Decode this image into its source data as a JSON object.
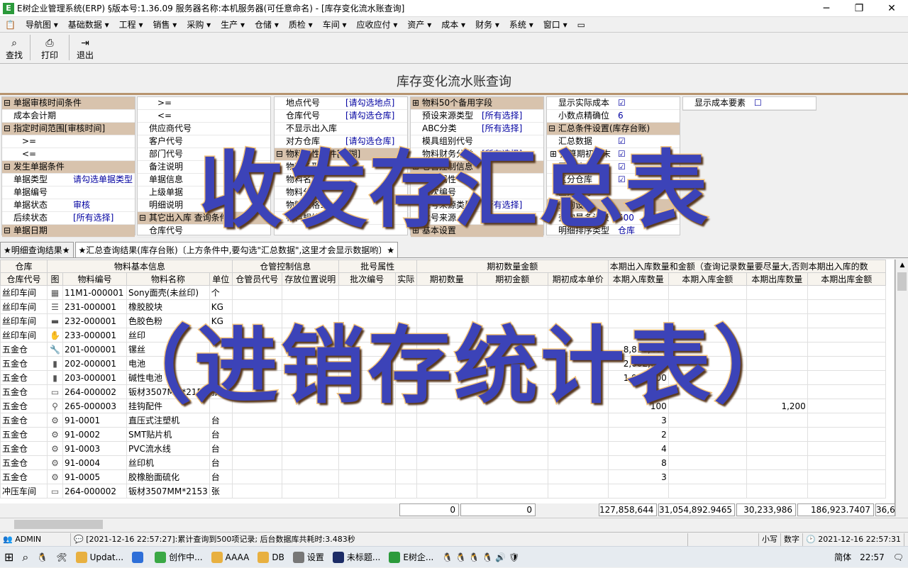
{
  "window": {
    "title": "E树企业管理系统(ERP) §版本号:1.36.09  服务器名称:本机服务器(可任意命名) - [库存变化流水账查询]",
    "minimize": "─",
    "maximize": "❐",
    "close": "✕"
  },
  "menu": [
    "导航图 ▾",
    "基础数据 ▾",
    "工程 ▾",
    "销售 ▾",
    "采购 ▾",
    "生产 ▾",
    "仓储 ▾",
    "质检 ▾",
    "车间 ▾",
    "应收应付 ▾",
    "资产 ▾",
    "成本 ▾",
    "财务 ▾",
    "系统 ▾",
    "窗口 ▾"
  ],
  "toolbar": {
    "find_label": "查找",
    "find_icon": "binoculars-icon",
    "print_label": "打印",
    "print_icon": "printer-icon",
    "exit_label": "退出",
    "exit_icon": "exit-door-icon"
  },
  "page_title": "库存变化流水账查询",
  "criteria": {
    "col1": [
      {
        "k": "⊟ 单据审核时间条件",
        "v": "",
        "group": true
      },
      {
        "k": "　成本会计期",
        "v": ""
      },
      {
        "k": "⊟ 指定时间范围[审核时间]",
        "v": "",
        "group": true
      },
      {
        "k": "　　>=",
        "v": ""
      },
      {
        "k": "　　<=",
        "v": ""
      },
      {
        "k": "⊟ 发生单据条件",
        "v": "",
        "group": true
      },
      {
        "k": "　单据类型",
        "v": "请勾选单据类型"
      },
      {
        "k": "　单据编号",
        "v": ""
      },
      {
        "k": "　单据状态",
        "v": "审核"
      },
      {
        "k": "　后续状态",
        "v": "[所有选择]"
      },
      {
        "k": "⊟ 单据日期",
        "v": "",
        "group": true
      }
    ],
    "col2": [
      {
        "k": "　　>=",
        "v": ""
      },
      {
        "k": "　　<=",
        "v": ""
      },
      {
        "k": "　供应商代号",
        "v": ""
      },
      {
        "k": "　客户代号",
        "v": ""
      },
      {
        "k": "　部门代号",
        "v": ""
      },
      {
        "k": "　备注说明",
        "v": ""
      },
      {
        "k": "　单据信息",
        "v": ""
      },
      {
        "k": "　上级单据",
        "v": ""
      },
      {
        "k": "　明细说明",
        "v": ""
      },
      {
        "k": "⊟ 其它出入库 查询条件",
        "v": "",
        "group": true
      },
      {
        "k": "　仓库代号",
        "v": ""
      }
    ],
    "col3": [
      {
        "k": "　地点代号",
        "v": "[请勾选地点]"
      },
      {
        "k": "　仓库代号",
        "v": "[请勾选仓库]"
      },
      {
        "k": "　不显示出入库",
        "v": ""
      },
      {
        "k": "　对方仓库",
        "v": "[请勾选仓库]"
      },
      {
        "k": "⊟ 物料属性条件[模糊]",
        "v": "",
        "group": true
      },
      {
        "k": "　物料条形码",
        "v": ""
      },
      {
        "k": "　物料名称",
        "v": ""
      },
      {
        "k": "　物料分类",
        "v": ""
      },
      {
        "k": "　物料规格1",
        "v": ""
      },
      {
        "k": "　物料规格2",
        "v": ""
      }
    ],
    "col4": [
      {
        "k": "⊞ 物料50个备用字段",
        "v": "",
        "group": true
      },
      {
        "k": "　预设来源类型",
        "v": "[所有选择]"
      },
      {
        "k": "　ABC分类",
        "v": "[所有选择]"
      },
      {
        "k": "　模具组别代号",
        "v": ""
      },
      {
        "k": "　物料财务分类",
        "v": "[所有选择]"
      },
      {
        "k": "⊞ 仓管控制信息",
        "v": "",
        "group": true
      },
      {
        "k": "　批号属性",
        "v": ""
      },
      {
        "k": "　批次编号",
        "v": ""
      },
      {
        "k": "　批号来源类型",
        "v": "[所有选择]"
      },
      {
        "k": "　批号来源",
        "v": ""
      },
      {
        "k": "⊞ 基本设置",
        "v": "",
        "group": true
      }
    ],
    "col5": [
      {
        "k": "　显示实际成本",
        "v": "☑"
      },
      {
        "k": "　小数点精确位",
        "v": "6"
      },
      {
        "k": "⊟ 汇总条件设置(库存台账)",
        "v": "",
        "group": true
      },
      {
        "k": "　汇总数据",
        "v": "☑"
      },
      {
        "k": "⊞ 推算期初期末",
        "v": "☑"
      },
      {
        "k": "　区分地点",
        "v": "☑"
      },
      {
        "k": "　区分仓库",
        "v": "☑"
      },
      {
        "k": "　区分批号",
        "v": ""
      },
      {
        "k": "⊟ 查询设置",
        "v": "",
        "group": true
      },
      {
        "k": "　查询最多记录",
        "v": "500"
      },
      {
        "k": "　明细排序类型",
        "v": "仓库"
      }
    ],
    "col6": [
      {
        "k": "　显示成本要素",
        "v": "☐"
      }
    ]
  },
  "tabs": {
    "detail": "★明细查询结果★",
    "summary": "★汇总查询结果(库存台账)〔上方条件中,要勾选\"汇总数据\",这里才会显示数据哟〕★"
  },
  "grid": {
    "group_headers": [
      "仓库",
      "物料基本信息",
      "仓管控制信息",
      "批号属性",
      "期初数量金额",
      "本期出入库数量和金额（查询记录数量要尽量大,否则本期出入库的数"
    ],
    "headers": [
      "仓库代号",
      "图",
      "物料编号",
      "物料名称",
      "单位",
      "仓管员代号",
      "存放位置说明",
      "批次编号",
      "实际",
      "期初数量",
      "期初金额",
      "期初成本单价",
      "本期入库数量",
      "本期入库金额",
      "本期出库数量",
      "本期出库金额"
    ],
    "rows": [
      [
        "丝印车间",
        "grid",
        "11M1-000001",
        "Sony面壳(未丝印)",
        "个",
        "",
        "",
        "",
        "",
        "",
        "",
        "",
        "",
        "",
        "",
        ""
      ],
      [
        "丝印车间",
        "stack",
        "231-000001",
        "橡胶胶块",
        "KG",
        "",
        "",
        "",
        "",
        "",
        "",
        "",
        "",
        "",
        "",
        ""
      ],
      [
        "丝印车间",
        "flag",
        "232-000001",
        "色胶色粉",
        "KG",
        "",
        "",
        "",
        "",
        "",
        "",
        "",
        "",
        "",
        "",
        ""
      ],
      [
        "丝印车间",
        "glove",
        "233-000001",
        "丝印",
        "",
        "",
        "",
        "",
        "",
        "",
        "",
        "",
        "",
        "",
        "",
        ""
      ],
      [
        "五金仓",
        "wrench",
        "201-000001",
        "镙丝",
        "",
        "",
        "",
        "",
        "",
        "",
        "",
        "",
        "8,810,400",
        "",
        "",
        ""
      ],
      [
        "五金仓",
        "battery",
        "202-000001",
        "电池",
        "",
        "",
        "",
        "",
        "",
        "",
        "",
        "",
        "2,002,600",
        "",
        "",
        ""
      ],
      [
        "五金仓",
        "battery",
        "203-000001",
        "碱性电池",
        "",
        "",
        "",
        "",
        "",
        "",
        "",
        "",
        "1,997,600",
        "",
        "",
        ""
      ],
      [
        "五金仓",
        "plate",
        "264-000002",
        "钣材3507MM*2153",
        "张",
        "",
        "",
        "",
        "",
        "",
        "",
        "",
        "20",
        "",
        "",
        ""
      ],
      [
        "五金仓",
        "hook",
        "265-000003",
        "挂钩配件",
        "",
        "",
        "",
        "",
        "",
        "",
        "",
        "",
        "100",
        "",
        "1,200",
        ""
      ],
      [
        "五金仓",
        "gear",
        "91-0001",
        "直压式注塑机",
        "台",
        "",
        "",
        "",
        "",
        "",
        "",
        "",
        "3",
        "",
        "",
        ""
      ],
      [
        "五金仓",
        "gear",
        "91-0002",
        "SMT贴片机",
        "台",
        "",
        "",
        "",
        "",
        "",
        "",
        "",
        "2",
        "",
        "",
        ""
      ],
      [
        "五金仓",
        "gear",
        "91-0003",
        "PVC流水线",
        "台",
        "",
        "",
        "",
        "",
        "",
        "",
        "",
        "4",
        "",
        "",
        ""
      ],
      [
        "五金仓",
        "gear",
        "91-0004",
        "丝印机",
        "台",
        "",
        "",
        "",
        "",
        "",
        "",
        "",
        "8",
        "",
        "",
        ""
      ],
      [
        "五金仓",
        "gear",
        "91-0005",
        "胶橡胎面硫化",
        "台",
        "",
        "",
        "",
        "",
        "",
        "",
        "",
        "3",
        "",
        "",
        ""
      ],
      [
        "冲压车间",
        "plate",
        "264-000002",
        "钣材3507MM*2153",
        "张",
        "",
        "",
        "",
        "",
        "",
        "",
        "",
        "",
        "",
        "",
        ""
      ]
    ],
    "totals": {
      "opening_qty": "0",
      "opening_amount": "0",
      "in_qty": "127,858,644",
      "in_amount": "31,054,892.9465",
      "out_qty": "30,233,986",
      "out_amount": "186,923.7407",
      "more": "36,6"
    }
  },
  "status": {
    "user": "ADMIN",
    "message": "[2021-12-16 22:57:27]:累计查询到500项记录; 后台数据库共耗时:3.483秒",
    "caps": "小写",
    "num": "数字",
    "datetime": "2021-12-16  22:57:31"
  },
  "taskbar": {
    "items": [
      "Updat...",
      "创作中...",
      "AAAA",
      "DB",
      "设置",
      "未标题...",
      "E树企..."
    ],
    "ime": "简体",
    "clock": "22:57"
  },
  "overlay": {
    "line1": "收发存汇总表",
    "line2": "（进销存统计表）"
  },
  "colors": {
    "group_bg": "#d8c3ad",
    "accent_line": "#b7946f",
    "overlay_fill": "#3c43b8",
    "overlay_stroke": "#f2c37b"
  }
}
